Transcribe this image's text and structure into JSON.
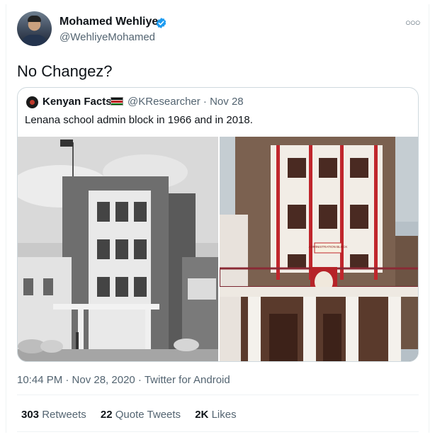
{
  "author": {
    "name": "Mohamed Wehliye",
    "handle": "@WehliyeMohamed",
    "verified": true
  },
  "tweet": {
    "text": "No Changez?"
  },
  "quoted": {
    "name": "Kenyan Facts",
    "handle_date": "@KResearcher · Nov 28",
    "text": "Lenana school admin block in 1966 and in 2018.",
    "photo_sign": "ADMINISTRATION BLOCK"
  },
  "meta": {
    "timestamp": "10:44 PM · Nov 28, 2020 · Twitter for Android"
  },
  "stats": {
    "retweets_count": "303",
    "retweets_label": "Retweets",
    "quotes_count": "22",
    "quotes_label": "Quote Tweets",
    "likes_count": "2K",
    "likes_label": "Likes"
  },
  "icons": {
    "more": "more-icon",
    "verified": "verified-badge-icon"
  },
  "colors": {
    "brand_blue": "#1d9bf0",
    "secondary_text": "#536471"
  }
}
